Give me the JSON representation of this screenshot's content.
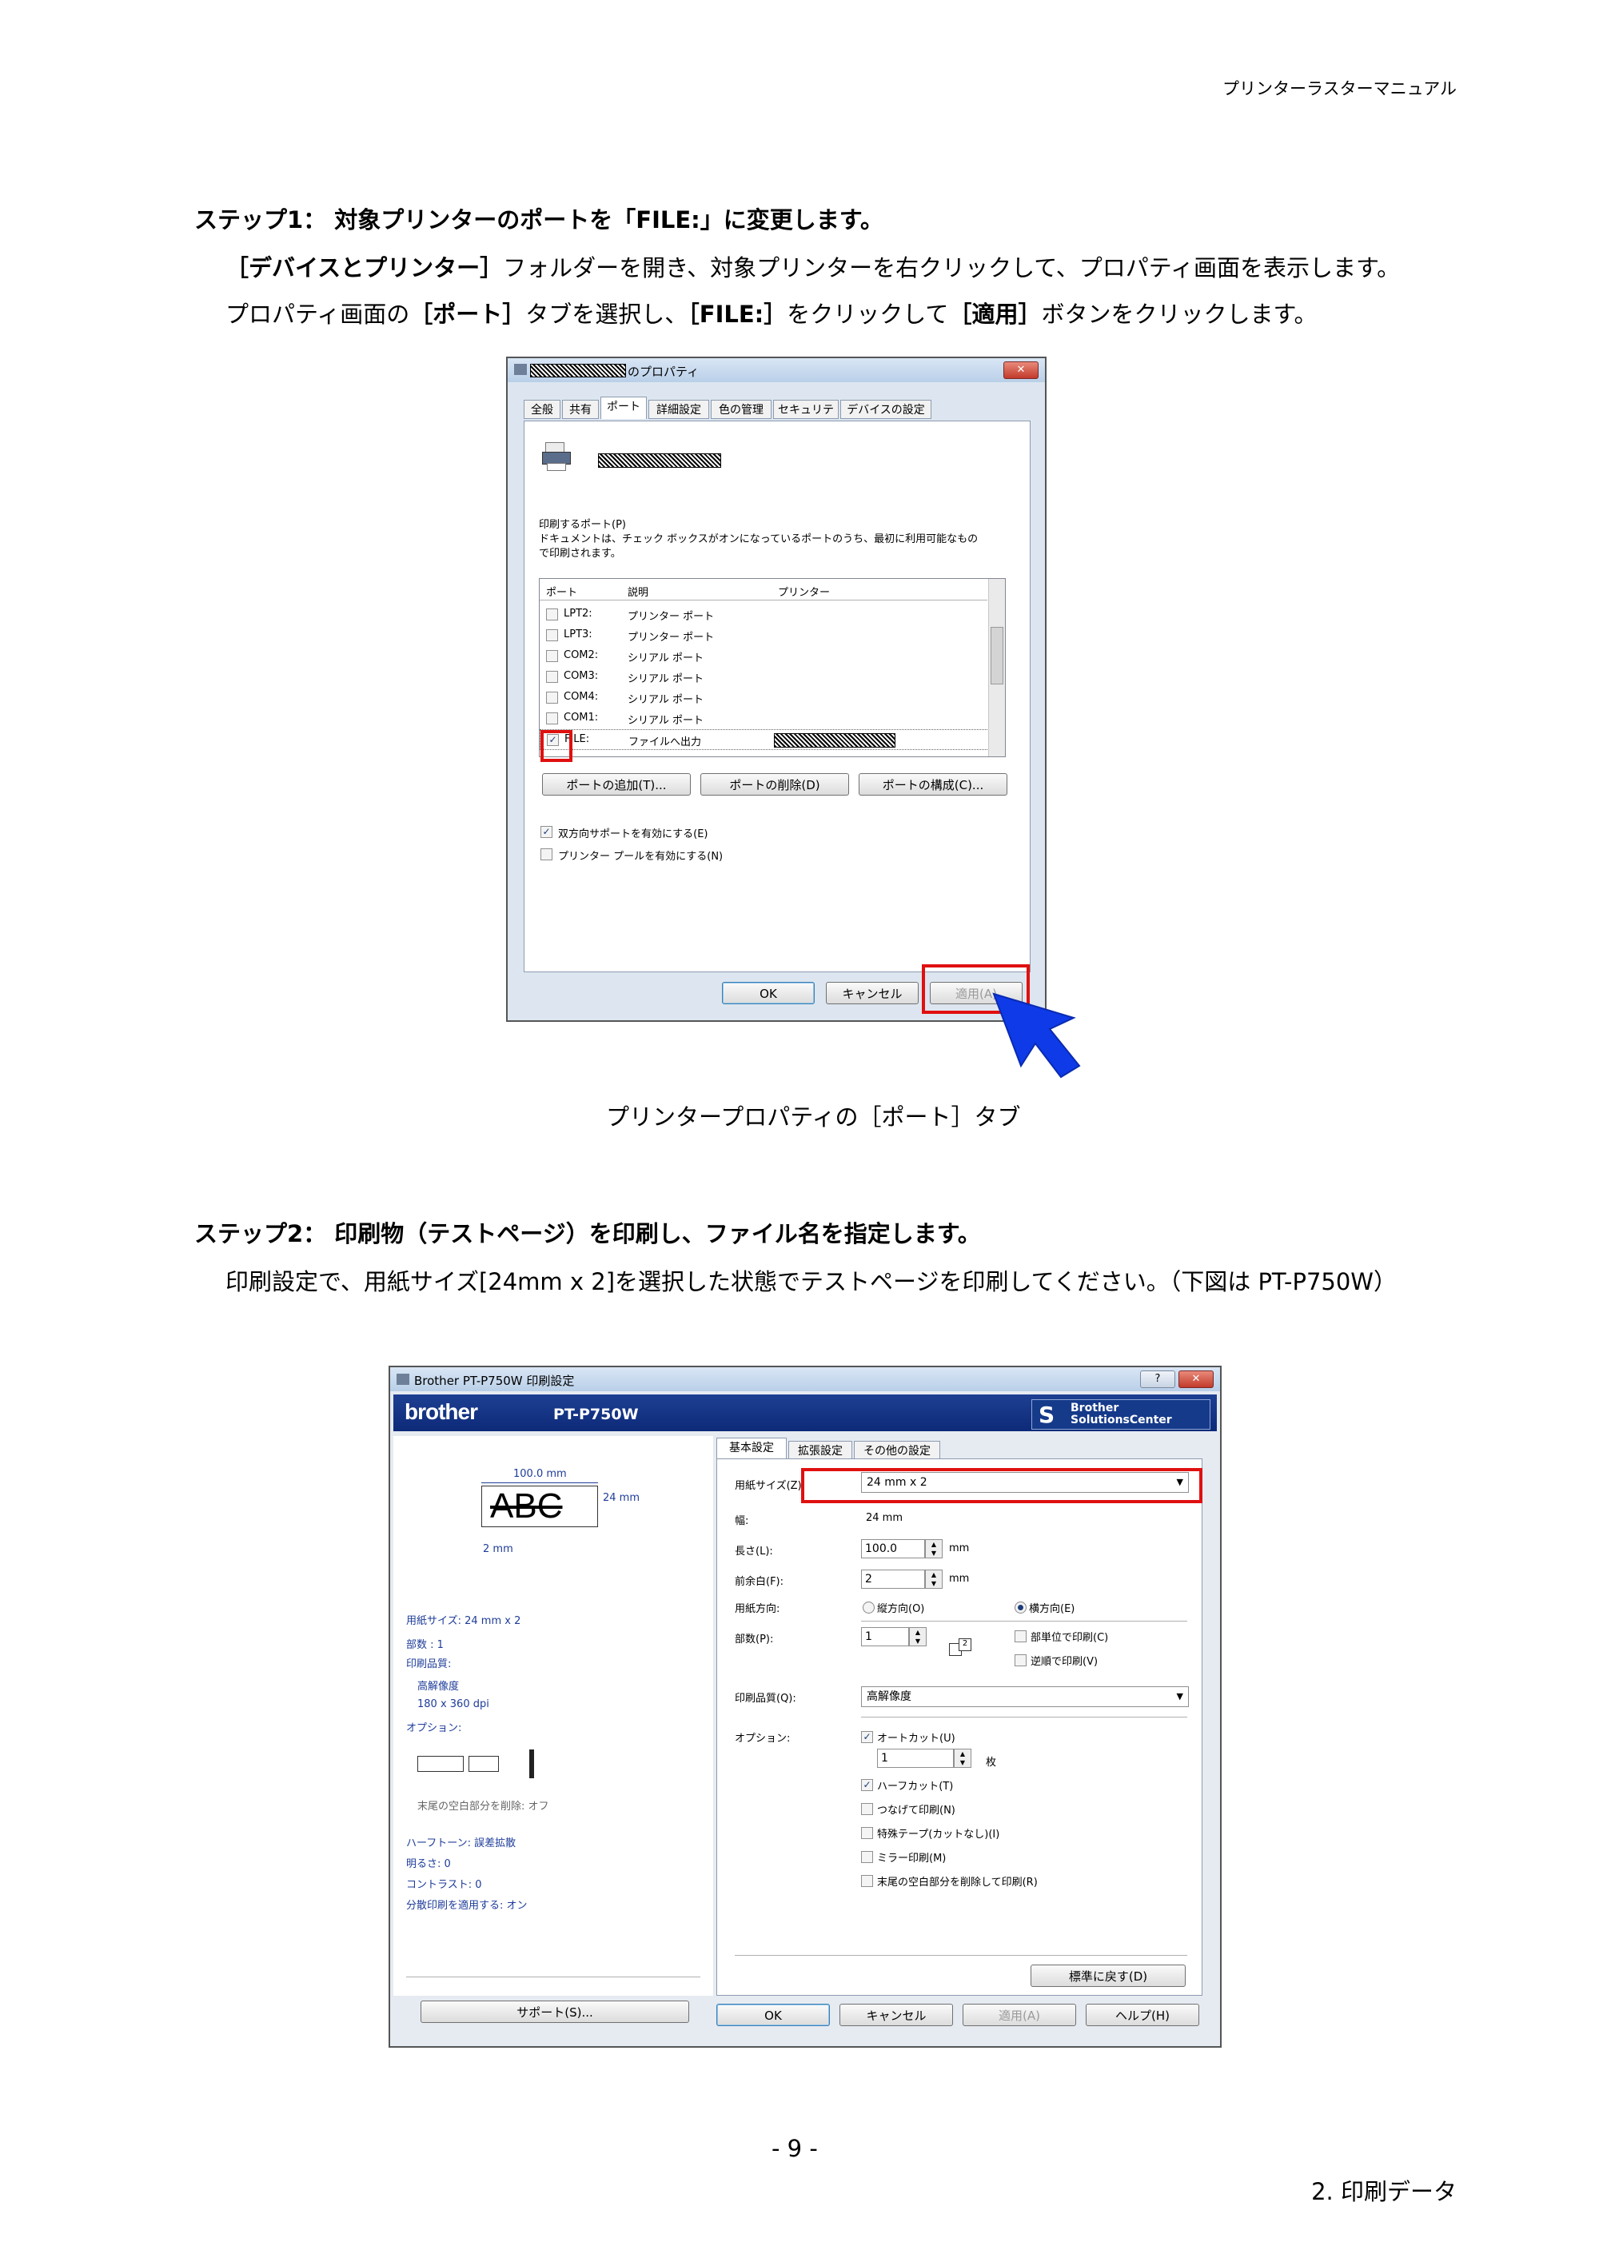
{
  "header": {
    "manual_title": "プリンターラスターマニュアル"
  },
  "step1": {
    "heading": "ステップ1： 対象プリンターのポートを「FILE:」に変更します。",
    "line1": {
      "b1": "［デバイスとプリンター］",
      "t1": "フォルダーを開き、対象プリンターを右クリックして、プロパティ画面を表示します。"
    },
    "line2": {
      "t1": "プロパティ画面の",
      "b1": "［ポート］",
      "t2": "タブを選択し、",
      "b2": "［FILE:］",
      "t3": "をクリックして",
      "b3": "［適用］",
      "t4": "ボタンをクリックします。"
    }
  },
  "dialog1": {
    "title_suffix": "のプロパティ",
    "close": "✕",
    "tabs": [
      "全般",
      "共有",
      "ポート",
      "詳細設定",
      "色の管理",
      "セキュリティ",
      "デバイスの設定"
    ],
    "ports_label": "印刷するポート(P)",
    "desc1": "ドキュメントは、チェック ボックスがオンになっているポートのうち、最初に利用可能なもの",
    "desc2": "で印刷されます。",
    "columns": [
      "ポート",
      "説明",
      "プリンター"
    ],
    "rows": [
      {
        "port": "LPT2:",
        "desc": "プリンター ポート",
        "checked": ""
      },
      {
        "port": "LPT3:",
        "desc": "プリンター ポート",
        "checked": ""
      },
      {
        "port": "COM2:",
        "desc": "シリアル ポート",
        "checked": ""
      },
      {
        "port": "COM3:",
        "desc": "シリアル ポート",
        "checked": ""
      },
      {
        "port": "COM4:",
        "desc": "シリアル ポート",
        "checked": ""
      },
      {
        "port": "COM1:",
        "desc": "シリアル ポート",
        "checked": ""
      },
      {
        "port": "FILE:",
        "desc": "ファイルへ出力",
        "checked": "✓"
      }
    ],
    "btn_add": "ポートの追加(T)...",
    "btn_delete": "ポートの削除(D)",
    "btn_config": "ポートの構成(C)...",
    "bidi": "双方向サポートを有効にする(E)",
    "pool": "プリンター プールを有効にする(N)",
    "ok": "OK",
    "cancel": "キャンセル",
    "apply": "適用(A)"
  },
  "caption1": "プリンタープロパティの［ポート］タブ",
  "step2": {
    "heading": "ステップ2： 印刷物（テストページ）を印刷し、ファイル名を指定します。",
    "line1": "印刷設定で、用紙サイズ[24mm x 2]を選択した状態でテストページを印刷してください。（下図は PT-P750W）"
  },
  "dialog2": {
    "title": "Brother PT-P750W 印刷設定",
    "help_btn": "?",
    "close": "✕",
    "logo": "brother",
    "model": "PT-P750W",
    "sc1": "Brother",
    "sc2": "SolutionsCenter",
    "preview": {
      "width": "100.0 mm",
      "height": "24 mm",
      "text": "ABC",
      "margin": "2 mm"
    },
    "summary": {
      "paper": "用紙サイズ: 24 mm x 2",
      "copies": "部数 : 1",
      "quality_label": "印刷品質:",
      "quality": "高解像度",
      "dpi": "180 x 360 dpi",
      "option_label": "オプション:",
      "trim": "末尾の空白部分を削除: オフ",
      "halftone": "ハーフトーン: 誤差拡散",
      "brightness": "明るさ:  0",
      "contrast": "コントラスト:  0",
      "split": "分散印刷を適用する: オン"
    },
    "support": "サポート(S)...",
    "tabs": [
      "基本設定",
      "拡張設定",
      "その他の設定"
    ],
    "paper_size_label": "用紙サイズ(Z):",
    "paper_size_value": "24 mm x 2",
    "width_label": "幅:",
    "width_value": "24 mm",
    "length_label": "長さ(L):",
    "length_value": "100.0",
    "feed_label": "前余白(F):",
    "feed_value": "2",
    "unit_mm": "mm",
    "orientation_label": "用紙方向:",
    "portrait": "縦方向(O)",
    "landscape": "横方向(E)",
    "copies_label": "部数(P):",
    "copies_value": "1",
    "collate": "部単位で印刷(C)",
    "reverse": "逆順で印刷(V)",
    "quality_label": "印刷品質(Q):",
    "quality_value": "高解像度",
    "options_label": "オプション:",
    "autocut": "オートカット(U)",
    "autocut_count": "1",
    "sheets": "枚",
    "halfcut": "ハーフカット(T)",
    "chain": "つなげて印刷(N)",
    "special": "特殊テープ(カットなし)(I)",
    "mirror": "ミラー印刷(M)",
    "trim": "末尾の空白部分を削除して印刷(R)",
    "default": "標準に戻す(D)",
    "ok": "OK",
    "cancel": "キャンセル",
    "apply": "適用(A)",
    "help": "ヘルプ(H)"
  },
  "footer": {
    "page": "- 9 -",
    "section": "2. 印刷データ"
  }
}
